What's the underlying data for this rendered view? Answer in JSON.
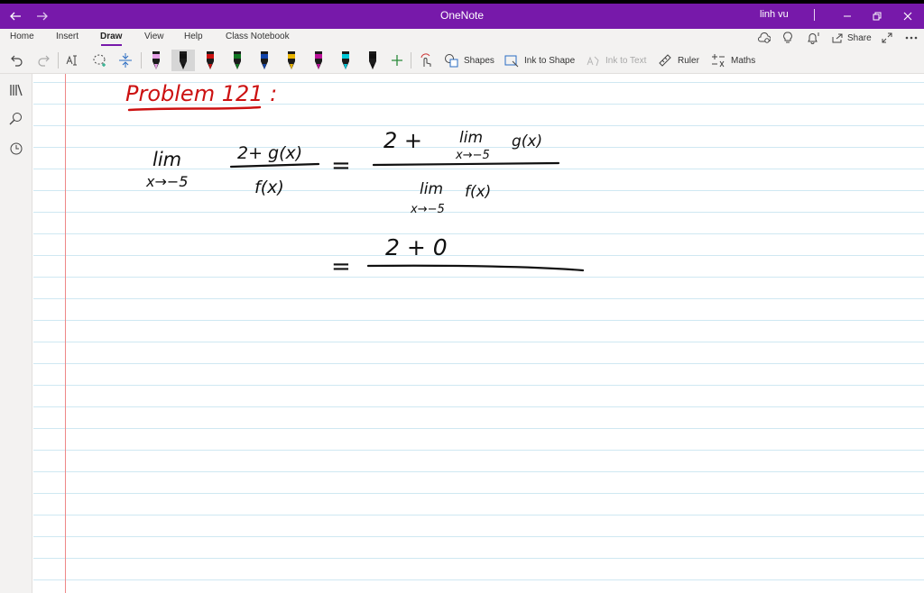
{
  "window": {
    "title": "OneNote",
    "user": "linh vu",
    "back_icon": "back-arrow-icon",
    "forward_icon": "forward-arrow-icon",
    "accent": "#7719aa"
  },
  "ribbon": {
    "tabs": [
      {
        "label": "Home"
      },
      {
        "label": "Insert"
      },
      {
        "label": "Draw"
      },
      {
        "label": "View"
      },
      {
        "label": "Help"
      },
      {
        "label": "Class Notebook"
      }
    ],
    "active_tab": "Draw",
    "share_label": "Share"
  },
  "toolbar": {
    "pens": [
      {
        "color": "#e6a0e6"
      },
      {
        "color": "#111111"
      },
      {
        "color": "#cc1111"
      },
      {
        "color": "#117722"
      },
      {
        "color": "#1144aa"
      },
      {
        "color": "#e8b400"
      },
      {
        "color": "#bb1199"
      },
      {
        "color": "#00c8d8"
      },
      {
        "color": "#111111"
      }
    ],
    "shapes_label": "Shapes",
    "ink_to_shape_label": "Ink to Shape",
    "ink_to_text_label": "Ink to Text",
    "ruler_label": "Ruler",
    "maths_label": "Maths"
  },
  "notes": {
    "heading": "Problem 121 :",
    "heading_color": "#cc1111",
    "ink_color": "#111111",
    "lim": "lim",
    "limit_sub": "x→−5",
    "numerator": "2+ g(x)",
    "denominator": "f(x)",
    "equals": "=",
    "rhs_numerator_lead": "2 +",
    "rhs_numerator_func": "g(x)",
    "rhs_denominator_func": "f(x)",
    "line2_numerator": "2 +  0"
  }
}
